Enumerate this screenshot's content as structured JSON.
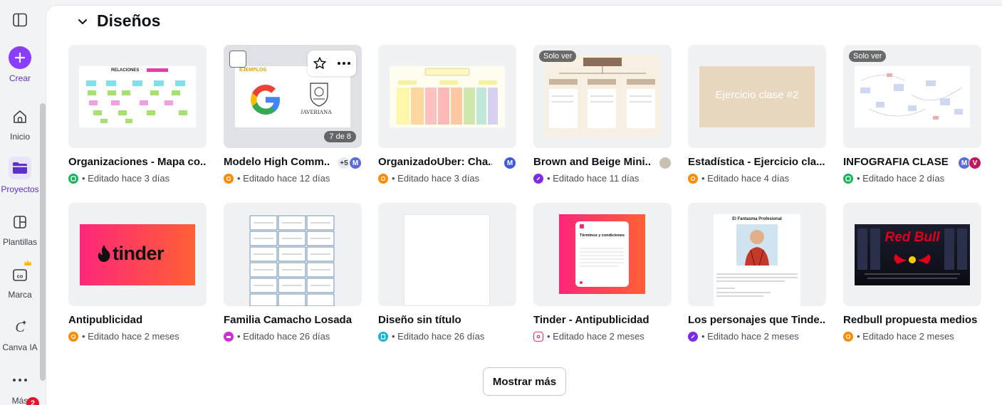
{
  "rail": {
    "create_label": "Crear",
    "items": [
      {
        "label": "Inicio",
        "icon": "home-icon"
      },
      {
        "label": "Proyectos",
        "icon": "folder-icon"
      },
      {
        "label": "Plantillas",
        "icon": "templates-icon"
      },
      {
        "label": "Marca",
        "icon": "brand-icon"
      },
      {
        "label": "Canva IA",
        "icon": "canva-ai-icon"
      },
      {
        "label": "Más",
        "icon": "more-icon"
      }
    ],
    "notification_count": "2"
  },
  "section": {
    "title": "Diseños"
  },
  "designs": [
    {
      "name": "Organizaciones - Mapa co...",
      "edited": "Editado hace 3 días",
      "app": "whiteboard"
    },
    {
      "name": "Modelo High Comm...",
      "edited": "Editado hace 12 días",
      "app": "presentation",
      "pages": "7 de 8",
      "avatars": [
        "+5",
        "M"
      ]
    },
    {
      "name": "OrganizadoUber: Cha...",
      "edited": "Editado hace 3 días",
      "app": "presentation",
      "avatars": [
        "M"
      ]
    },
    {
      "name": "Brown and Beige Mini...",
      "edited": "Editado hace 11 días",
      "app": "whiteboard-purple",
      "badge": "Solo ver"
    },
    {
      "name": "Estadística - Ejercicio cla...",
      "edited": "Editado hace 4 días",
      "app": "presentation",
      "thumb_text": "Ejercicio clase #2"
    },
    {
      "name": "INFOGRAFIA CLASE ...",
      "edited": "Editado hace 2 días",
      "app": "whiteboard",
      "badge": "Solo ver",
      "avatars": [
        "M",
        "V"
      ]
    },
    {
      "name": "Antipublicidad",
      "edited": "Editado hace 2 meses",
      "app": "presentation",
      "thumb_text": "tinder"
    },
    {
      "name": "Familia Camacho Losada",
      "edited": "Editado hace 26 días",
      "app": "print"
    },
    {
      "name": "Diseño sin título",
      "edited": "Editado hace 26 días",
      "app": "doc"
    },
    {
      "name": "Tinder - Antipublicidad",
      "edited": "Editado hace 2 meses",
      "app": "instagram",
      "thumb_text": "Términos y condiciones"
    },
    {
      "name": "Los personajes que Tinde...",
      "edited": "Editado hace 2 meses",
      "app": "whiteboard-purple",
      "thumb_text": "El Fantasma Profesional"
    },
    {
      "name": "Redbull propuesta medios",
      "edited": "Editado hace 2 meses",
      "app": "presentation",
      "thumb_text": "Red Bull"
    }
  ],
  "thumb_extra": {
    "examples": "EJEMPLOS",
    "javeriana": "JAVERIANA",
    "relaciones": "RELACIONES"
  },
  "show_more_label": "Mostrar más",
  "colors": {
    "accent": "#8b3dff",
    "presentation": "#ff8b00",
    "whiteboard": "#17b35a",
    "whiteboard_purple": "#7d2ae8"
  }
}
